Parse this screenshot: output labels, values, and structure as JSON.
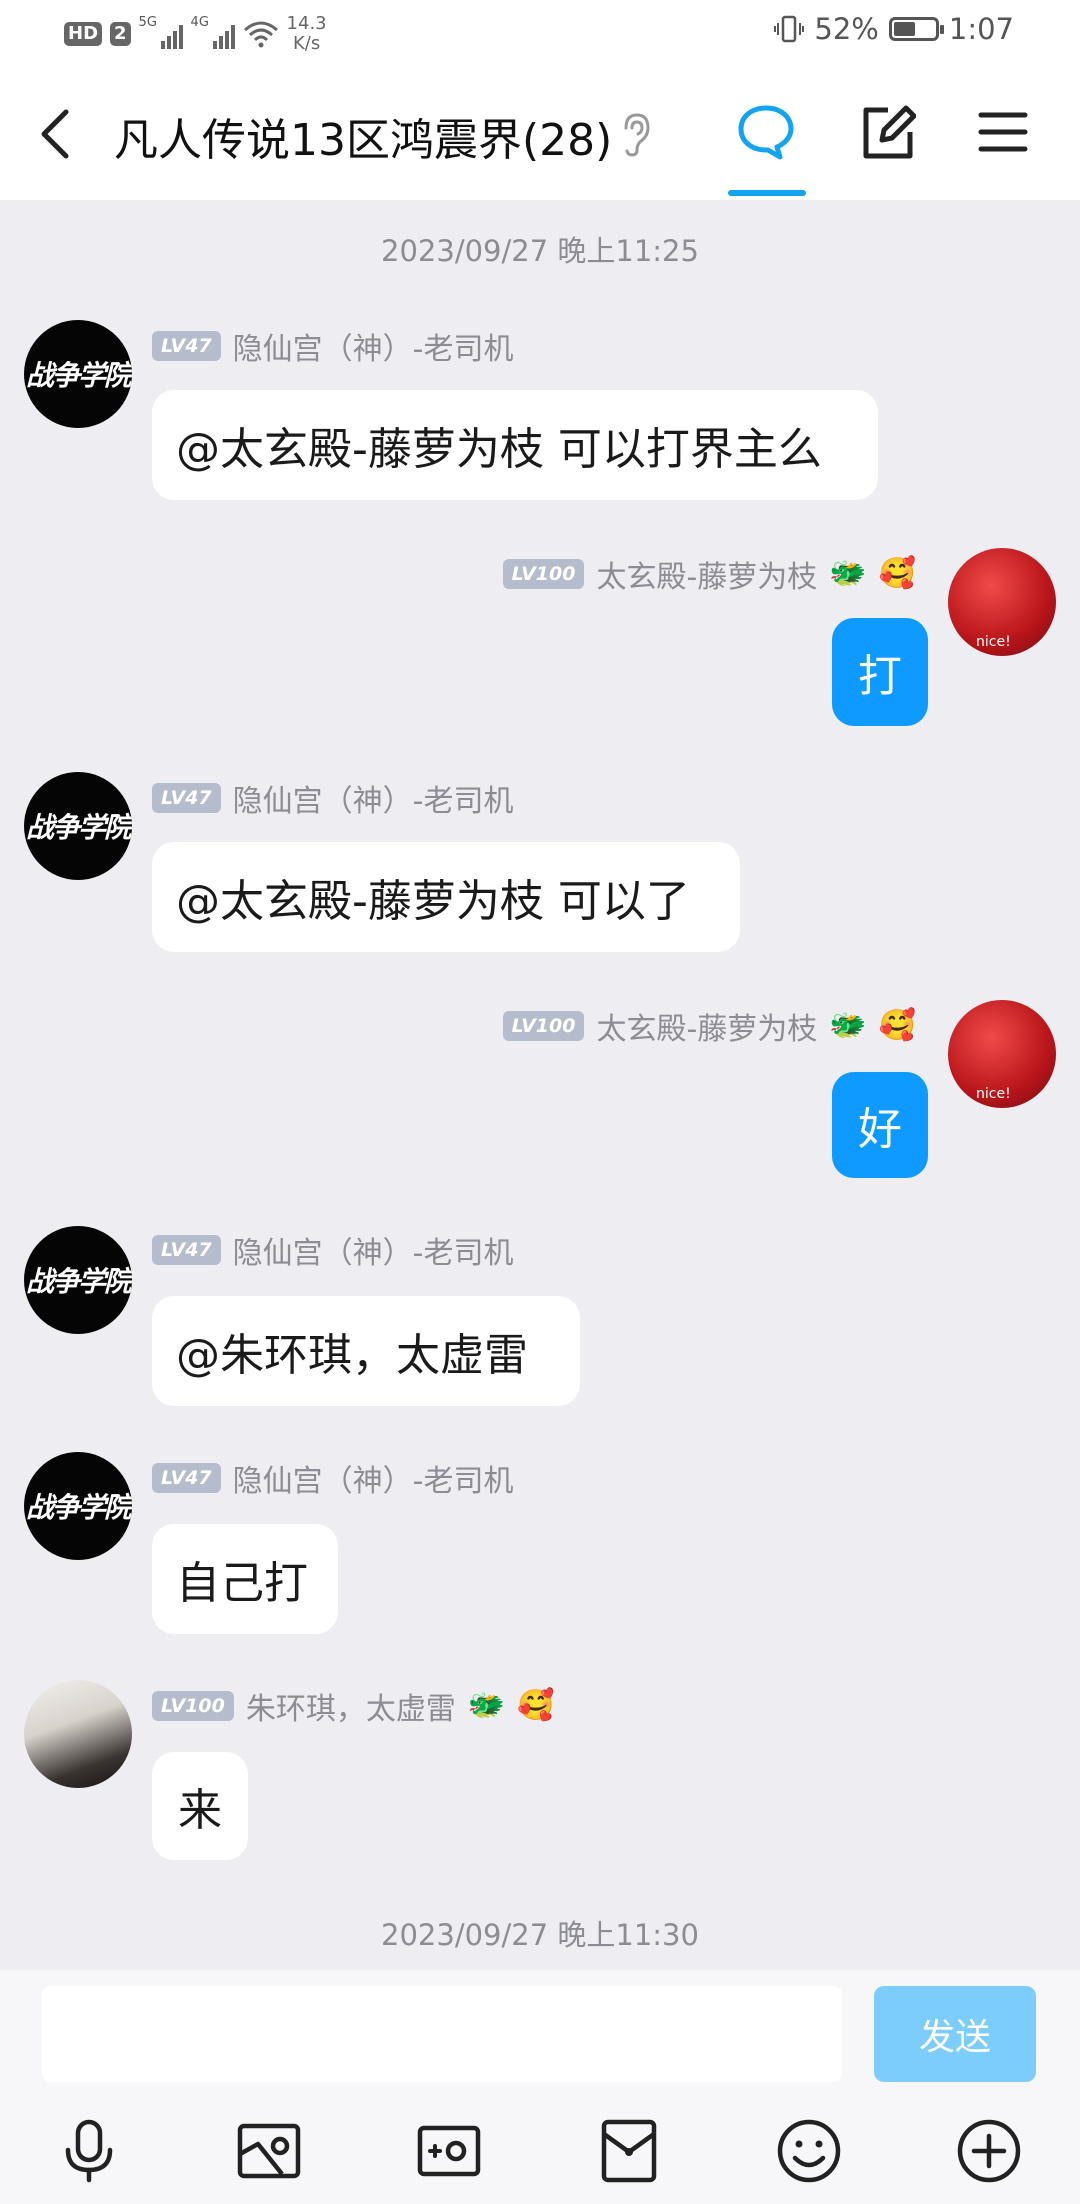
{
  "status": {
    "hd": "HD",
    "sim": "2",
    "net1": "5G",
    "net2": "4G",
    "speed_value": "14.3",
    "speed_unit": "K/s",
    "battery": "52%",
    "battery_level": 0.52,
    "time": "1:07"
  },
  "header": {
    "title": "凡人传说13区鸿震界(28)"
  },
  "timestamps": [
    "2023/09/27 晚上11:25",
    "2023/09/27 晚上11:30"
  ],
  "messages": [
    {
      "level": "LV47",
      "sender": "隐仙宫（神）-老司机",
      "text": "@太玄殿-藤萝为枝 可以打界主么",
      "avatar_text": "战争学院"
    },
    {
      "level": "LV100",
      "sender": "太玄殿-藤萝为枝",
      "text": "打",
      "avatar_text": "nice!"
    },
    {
      "level": "LV47",
      "sender": "隐仙宫（神）-老司机",
      "text": "@太玄殿-藤萝为枝 可以了",
      "avatar_text": "战争学院"
    },
    {
      "level": "LV100",
      "sender": "太玄殿-藤萝为枝",
      "text": "好",
      "avatar_text": "nice!"
    },
    {
      "level": "LV47",
      "sender": "隐仙宫（神）-老司机",
      "text": "@朱环琪，太虚雷",
      "avatar_text": "战争学院"
    },
    {
      "level": "LV47",
      "sender": "隐仙宫（神）-老司机",
      "text": "自己打",
      "avatar_text": "战争学院"
    },
    {
      "level": "LV100",
      "sender": "朱环琪，太虚雷",
      "text": "来"
    }
  ],
  "badges": {
    "dragon": "🐲",
    "face": "🥰"
  },
  "input": {
    "placeholder": "",
    "send_label": "发送"
  }
}
